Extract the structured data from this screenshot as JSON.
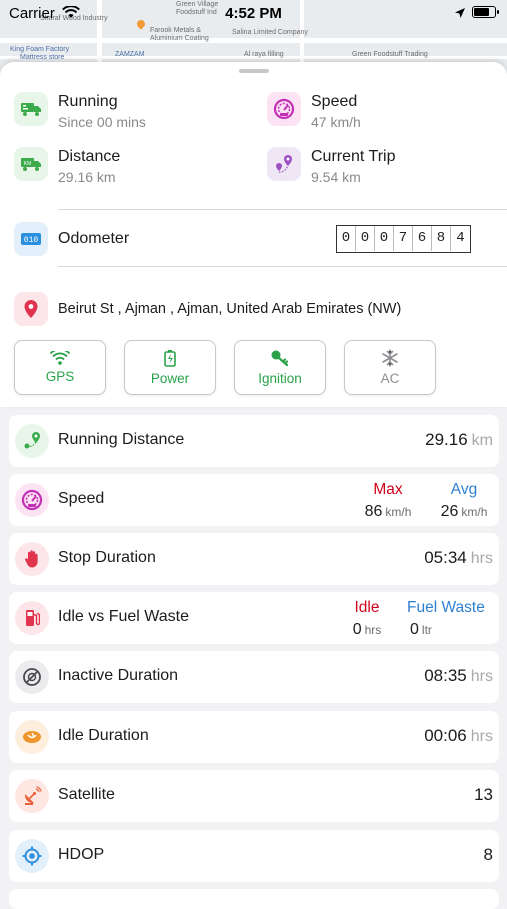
{
  "status_bar": {
    "carrier": "Carrier",
    "time": "4:52 PM"
  },
  "map": {
    "labels": [
      "Green Village",
      "Foodstuff Ind",
      "Sharaf Wood Industry",
      "Farook Metals &",
      "Aluminium Coating",
      "Salina Limited Company",
      "King Foam Factory",
      "Mattress store",
      "ZAMZAM",
      "Al raya filling",
      "Green Foodstuff Trading"
    ]
  },
  "summary": {
    "running": {
      "title": "Running",
      "sub": "Since 00 mins"
    },
    "speed": {
      "title": "Speed",
      "sub": "47 km/h"
    },
    "distance": {
      "title": "Distance",
      "sub": "29.16 km"
    },
    "current_trip": {
      "title": "Current Trip",
      "sub": "9.54 km"
    }
  },
  "odometer": {
    "label": "Odometer",
    "digits": [
      "0",
      "0",
      "0",
      "7",
      "6",
      "8",
      "4"
    ]
  },
  "address": "Beirut St , Ajman , Ajman, United Arab Emirates (NW)",
  "chips": [
    {
      "label": "GPS",
      "color": "#2aa24a",
      "icon": "wifi-icon"
    },
    {
      "label": "Power",
      "color": "#2aa24a",
      "icon": "battery-icon"
    },
    {
      "label": "Ignition",
      "color": "#2aa24a",
      "icon": "key-icon"
    },
    {
      "label": "AC",
      "color": "#8e8e93",
      "icon": "snowflake-icon"
    }
  ],
  "cards": {
    "running_distance": {
      "title": "Running Distance",
      "value": "29.16",
      "unit": "km"
    },
    "speed": {
      "title": "Speed",
      "max_label": "Max",
      "max_value": "86",
      "max_unit": "km/h",
      "avg_label": "Avg",
      "avg_value": "26",
      "avg_unit": "km/h"
    },
    "stop_duration": {
      "title": "Stop Duration",
      "value": "05:34",
      "unit": "hrs"
    },
    "idle_fuel": {
      "title": "Idle vs Fuel Waste",
      "idle_label": "Idle",
      "idle_value": "0",
      "idle_unit": "hrs",
      "fuel_label": "Fuel Waste",
      "fuel_value": "0",
      "fuel_unit": "ltr"
    },
    "inactive_duration": {
      "title": "Inactive Duration",
      "value": "08:35",
      "unit": "hrs"
    },
    "idle_duration": {
      "title": "Idle Duration",
      "value": "00:06",
      "unit": "hrs"
    },
    "satellite": {
      "title": "Satellite",
      "value": "13"
    },
    "hdop": {
      "title": "HDOP",
      "value": "8"
    }
  },
  "colors": {
    "accent_green": "#2aa24a",
    "max_red": "#d0021b",
    "avg_blue": "#2f7fd1"
  }
}
